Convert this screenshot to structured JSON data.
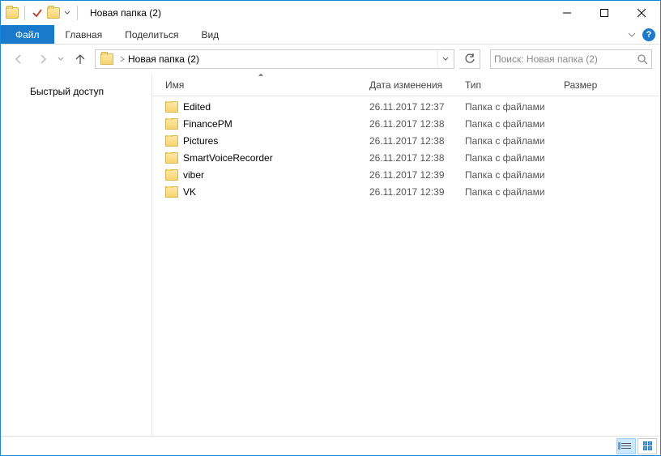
{
  "window": {
    "title": "Новая папка (2)"
  },
  "ribbon": {
    "file": "Файл",
    "home": "Главная",
    "share": "Поделиться",
    "view": "Вид"
  },
  "address": {
    "segment": "Новая папка (2)"
  },
  "search": {
    "placeholder": "Поиск: Новая папка (2)"
  },
  "sidebar": {
    "quick_access": "Быстрый доступ"
  },
  "columns": {
    "name": "Имя",
    "date": "Дата изменения",
    "type": "Тип",
    "size": "Размер"
  },
  "items": [
    {
      "name": "Edited",
      "date": "26.11.2017 12:37",
      "type": "Папка с файлами",
      "size": ""
    },
    {
      "name": "FinancePM",
      "date": "26.11.2017 12:38",
      "type": "Папка с файлами",
      "size": ""
    },
    {
      "name": "Pictures",
      "date": "26.11.2017 12:38",
      "type": "Папка с файлами",
      "size": ""
    },
    {
      "name": "SmartVoiceRecorder",
      "date": "26.11.2017 12:38",
      "type": "Папка с файлами",
      "size": ""
    },
    {
      "name": "viber",
      "date": "26.11.2017 12:39",
      "type": "Папка с файлами",
      "size": ""
    },
    {
      "name": "VK",
      "date": "26.11.2017 12:39",
      "type": "Папка с файлами",
      "size": ""
    }
  ]
}
